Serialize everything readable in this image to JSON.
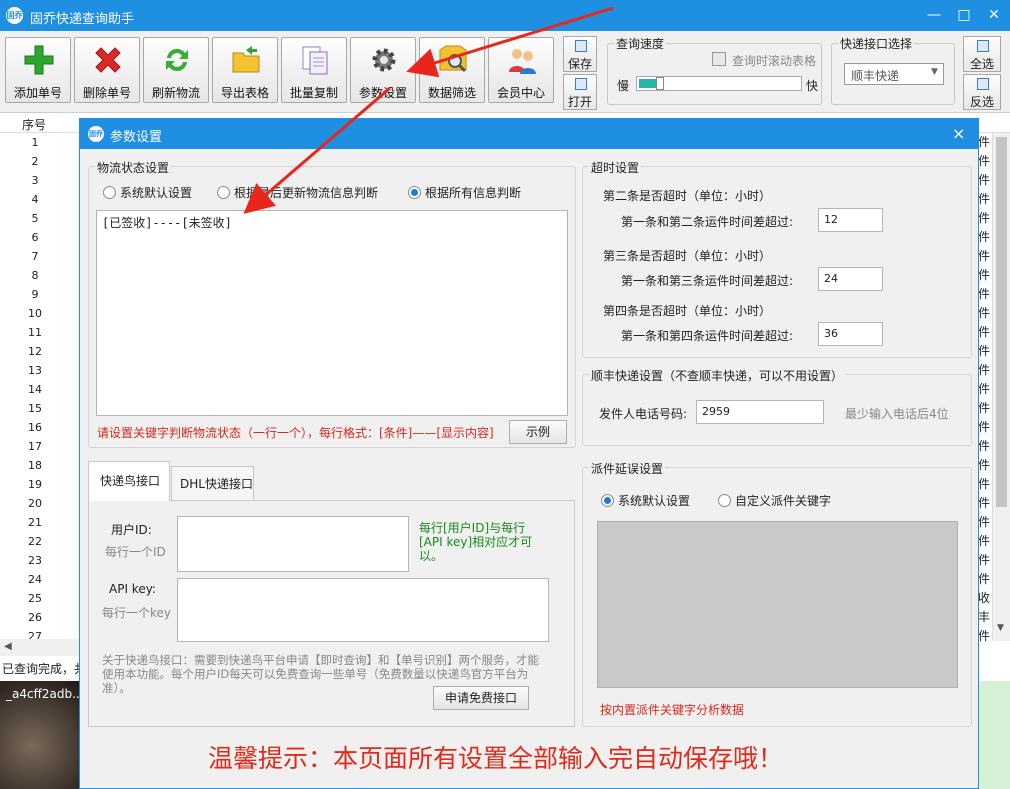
{
  "app": {
    "title": "固乔快递查询助手",
    "icon_text": "固乔"
  },
  "toolbar": {
    "buttons": [
      {
        "label": "添加单号",
        "icon": "add-icon"
      },
      {
        "label": "删除单号",
        "icon": "delete-icon"
      },
      {
        "label": "刷新物流",
        "icon": "refresh-icon"
      },
      {
        "label": "导出表格",
        "icon": "export-folder-icon"
      },
      {
        "label": "批量复制",
        "icon": "copy-icon"
      },
      {
        "label": "参数设置",
        "icon": "gear-icon"
      },
      {
        "label": "数据筛选",
        "icon": "filter-icon"
      },
      {
        "label": "会员中心",
        "icon": "members-icon"
      }
    ],
    "save_label": "保存",
    "open_label": "打开",
    "speed_group": "查询速度",
    "scroll_check": "查询时滚动表格",
    "slow_label": "慢",
    "fast_label": "快",
    "speed_value": 0.12,
    "api_group": "快递接口选择",
    "api_select": "顺丰快递",
    "select_all": "全选",
    "invert": "反选"
  },
  "table": {
    "header_first": "序号",
    "row_numbers": [
      "1",
      "2",
      "3",
      "4",
      "5",
      "6",
      "7",
      "8",
      "9",
      "10",
      "11",
      "12",
      "13",
      "14",
      "15",
      "16",
      "17",
      "18",
      "19",
      "20",
      "21",
      "22",
      "23",
      "24",
      "25",
      "26",
      "27"
    ],
    "right_cells": [
      "件",
      "件",
      "件",
      "件",
      "件",
      "件",
      "件",
      "件",
      "件",
      "件",
      "件",
      "件",
      "件",
      "件",
      "件",
      "件",
      "件",
      "件",
      "件",
      "件",
      "件",
      "件",
      "件",
      "件",
      "收",
      "丰",
      "件"
    ]
  },
  "status": {
    "text": "已查询完成，共",
    "thumb_text": "_a4cff2adb..."
  },
  "dialog": {
    "title": "参数设置",
    "close": "×",
    "logistics": {
      "group": "物流状态设置",
      "radios": [
        "系统默认设置",
        "根据最后更新物流信息判断",
        "根据所有信息判断"
      ],
      "selected": 2,
      "textarea": "[已签收]----[未签收]",
      "hint": "请设置关键字判断物流状态（一行一个），每行格式：[条件]——[显示内容]",
      "example_button": "示例"
    },
    "timeout": {
      "group": "超时设置",
      "items": [
        {
          "title": "第二条是否超时（单位：小时）",
          "label": "第一条和第二条运件时间差超过:",
          "value": "12"
        },
        {
          "title": "第三条是否超时（单位：小时）",
          "label": "第一条和第三条运件时间差超过:",
          "value": "24"
        },
        {
          "title": "第四条是否超时（单位：小时）",
          "label": "第一条和第四条运件时间差超过:",
          "value": "36"
        }
      ]
    },
    "sf": {
      "group": "顺丰快递设置（不查顺丰快递，可以不用设置）",
      "phone_label": "发件人电话号码:",
      "phone_value": "2959",
      "phone_hint": "最少输入电话后4位"
    },
    "tabs": [
      "快递鸟接口",
      "DHL快递接口"
    ],
    "active_tab": 0,
    "kdn": {
      "user_label": "用户ID:",
      "user_sub": "每行一个ID",
      "note": "每行[用户ID]与每行[API key]相对应才可以。",
      "key_label": "API key:",
      "key_sub": "每行一个key",
      "about": "关于快递鸟接口：需要到快递鸟平台申请【即时查询】和【单号识别】两个服务，才能使用本功能。每个用户ID每天可以免费查询一些单号（免费数量以快递鸟官方平台为准）。",
      "apply_button": "申请免费接口"
    },
    "delay": {
      "group": "派件延误设置",
      "radios": [
        "系统默认设置",
        "自定义派件关键字"
      ],
      "selected": 0,
      "hint": "按内置派件关键字分析数据"
    },
    "tip": "温馨提示：本页面所有设置全部输入完自动保存哦！"
  },
  "colors": {
    "title_blue": "#1e8fe1",
    "hint_red": "#d42a1e",
    "note_green": "#1a8a1a",
    "arrow_red": "#e8261c",
    "slider_teal": "#28b4a8"
  }
}
